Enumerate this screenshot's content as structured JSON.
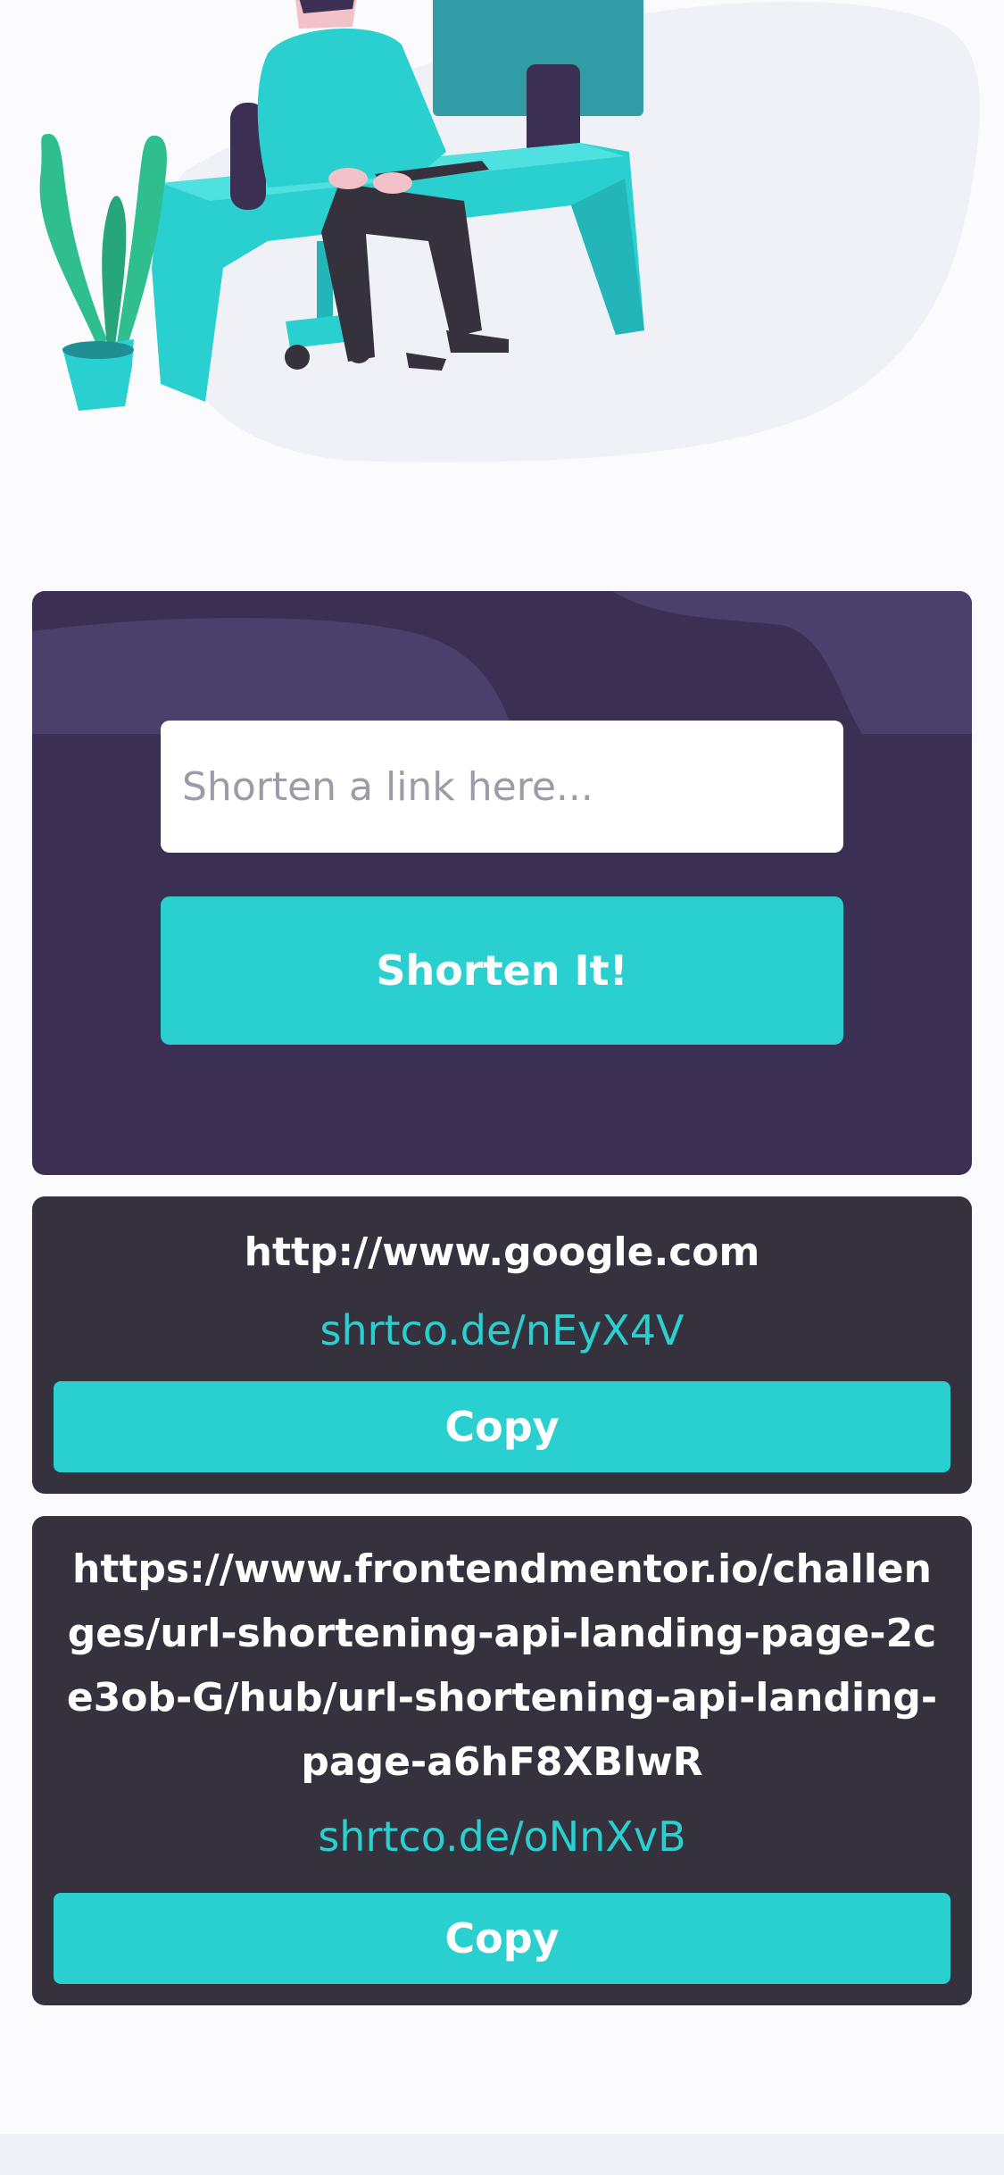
{
  "shorten": {
    "input_placeholder": "Shorten a link here...",
    "input_value": "",
    "button_label": "Shorten It!"
  },
  "results": [
    {
      "original": "http://www.google.com",
      "short": "shrtco.de/nEyX4V",
      "copy_label": "Copy"
    },
    {
      "original": "https://www.frontendmentor.io/challenges/url-shortening-api-landing-page-2ce3ob-G/hub/url-shortening-api-landing-page-a6hF8XBlwR",
      "short": "shrtco.de/oNnXvB",
      "copy_label": "Copy"
    }
  ],
  "colors": {
    "accent": "#2acfcf",
    "panel": "#3b3054",
    "card": "#35323e",
    "background": "#fbfbfd"
  },
  "icons": [
    "working-person-illustration",
    "plant-illustration"
  ]
}
